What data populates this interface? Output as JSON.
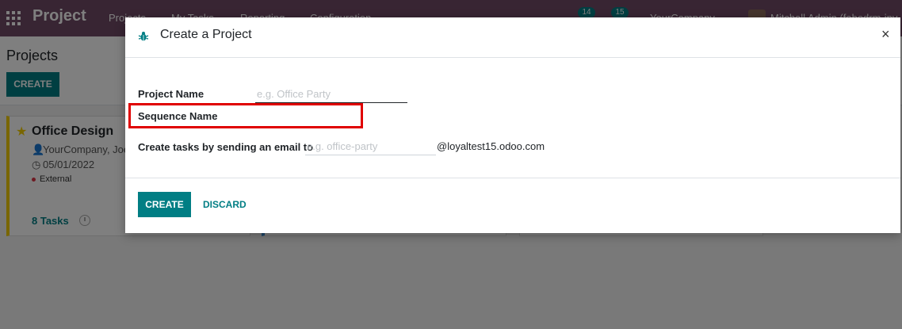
{
  "navbar": {
    "brand": "Project",
    "menu": [
      "Projects",
      "My Tasks",
      "Reporting",
      "Configuration"
    ],
    "chat_count": "14",
    "activity_count": "15",
    "company": "YourCompany",
    "user": "Mitchell Admin (fabodrm-inv"
  },
  "control_panel": {
    "title": "Projects",
    "create_label": "CREATE"
  },
  "kanban": {
    "card": {
      "title": "Office Design",
      "customer": "YourCompany, Joe",
      "date": "05/01/2022",
      "tag": "External",
      "tasks": "8 Tasks"
    }
  },
  "dialog": {
    "title": "Create a Project",
    "close_glyph": "×",
    "project_name_label": "Project Name",
    "project_name_placeholder": "e.g. Office Party",
    "sequence_name_label": "Sequence Name",
    "email_label": "Create tasks by sending an email to",
    "email_placeholder": "e.g. office-party",
    "email_domain": "@loyaltest15.odoo.com",
    "create_label": "CREATE",
    "discard_label": "DISCARD"
  },
  "colors": {
    "navbar": "#714b67",
    "primary": "#017e84",
    "highlight": "#e00000",
    "favorite_star": "#f3cc00"
  },
  "icons": [
    "apps-grid-icon",
    "bug-icon",
    "star-icon",
    "user-icon",
    "clock-icon",
    "calendar-icon",
    "close-icon"
  ]
}
